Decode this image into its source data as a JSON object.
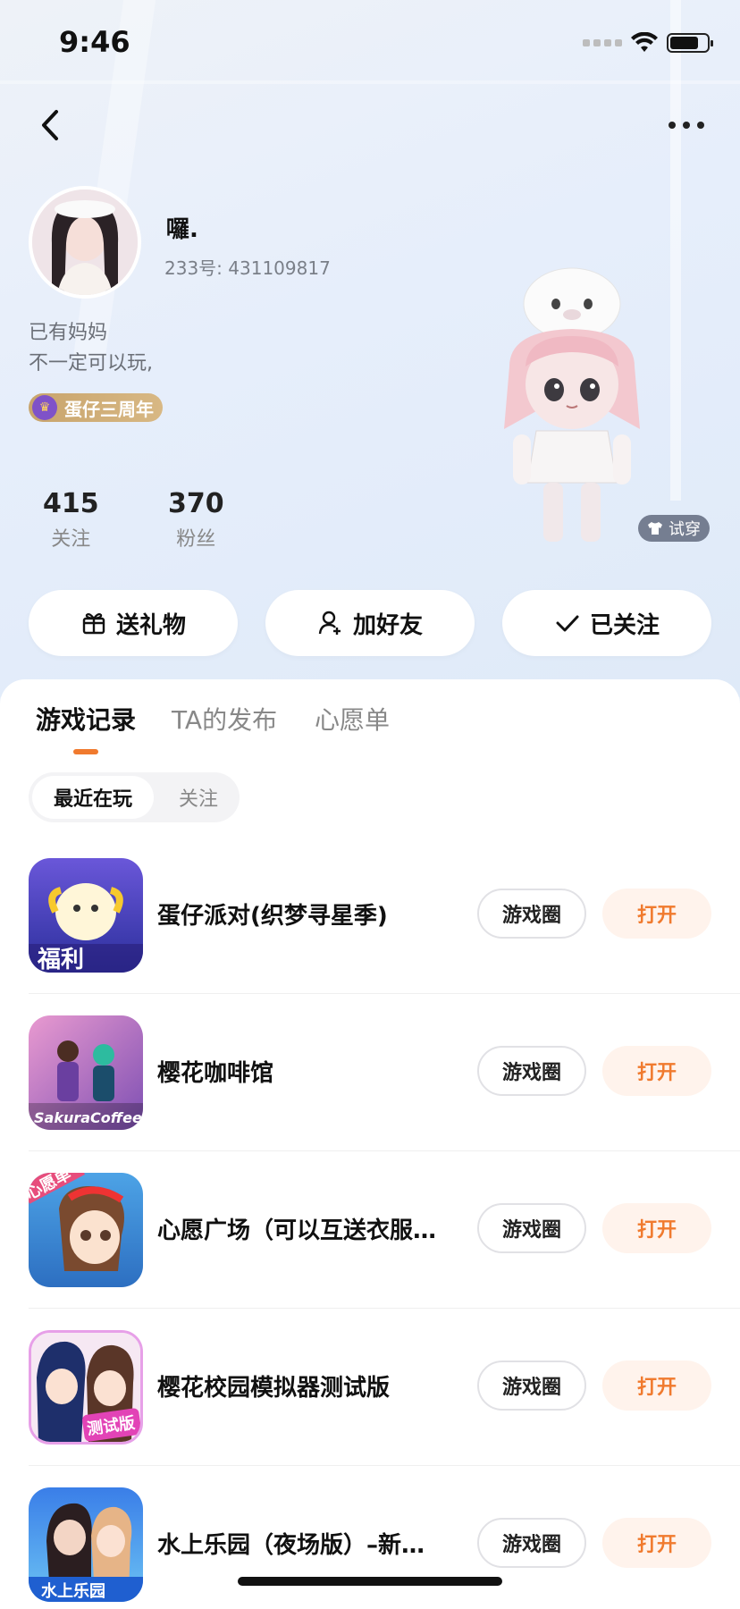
{
  "status_bar": {
    "time": "9:46"
  },
  "profile": {
    "username": "囉.",
    "user_id": "233号: 431109817",
    "bio_line1": "已有妈妈",
    "bio_line2": "不一定可以玩,",
    "badge_label": "蛋仔三周年",
    "try_on_label": "试穿"
  },
  "stats": [
    {
      "value": "415",
      "label": "关注"
    },
    {
      "value": "370",
      "label": "粉丝"
    }
  ],
  "actions": {
    "gift": "送礼物",
    "add_friend": "加好友",
    "followed": "已关注"
  },
  "tabs": [
    {
      "label": "游戏记录",
      "active": true
    },
    {
      "label": "TA的发布",
      "active": false
    },
    {
      "label": "心愿单",
      "active": false
    }
  ],
  "segment": {
    "recent": "最近在玩",
    "follow": "关注"
  },
  "games": [
    {
      "title": "蛋仔派对(织梦寻星季)",
      "icon": "eggy-party-icon",
      "icon_text": "福利",
      "color_a": "#6a57d9",
      "color_b": "#2b2f9c"
    },
    {
      "title": "樱花咖啡馆",
      "icon": "sakura-cafe-icon",
      "icon_text": "SakuraCoffee",
      "color_a": "#e99ad0",
      "color_b": "#7d4fb3"
    },
    {
      "title": "心愿广场（可以互送衣服…",
      "icon": "wish-plaza-icon",
      "icon_text": "心愿单",
      "color_a": "#4da3e6",
      "color_b": "#2d6fc1"
    },
    {
      "title": "樱花校园模拟器测试版",
      "icon": "sakura-school-icon",
      "icon_text": "测试版",
      "color_a": "#f3a8e6",
      "color_b": "#3c4b9a"
    },
    {
      "title": "水上乐园（夜场版）–新…",
      "icon": "water-park-icon",
      "icon_text": "水上乐园",
      "color_a": "#3a7ee8",
      "color_b": "#6cc3f4"
    }
  ],
  "game_buttons": {
    "circle": "游戏圈",
    "open": "打开"
  },
  "colors": {
    "accent": "#f07a2e",
    "open_bg": "#fff3ec"
  }
}
